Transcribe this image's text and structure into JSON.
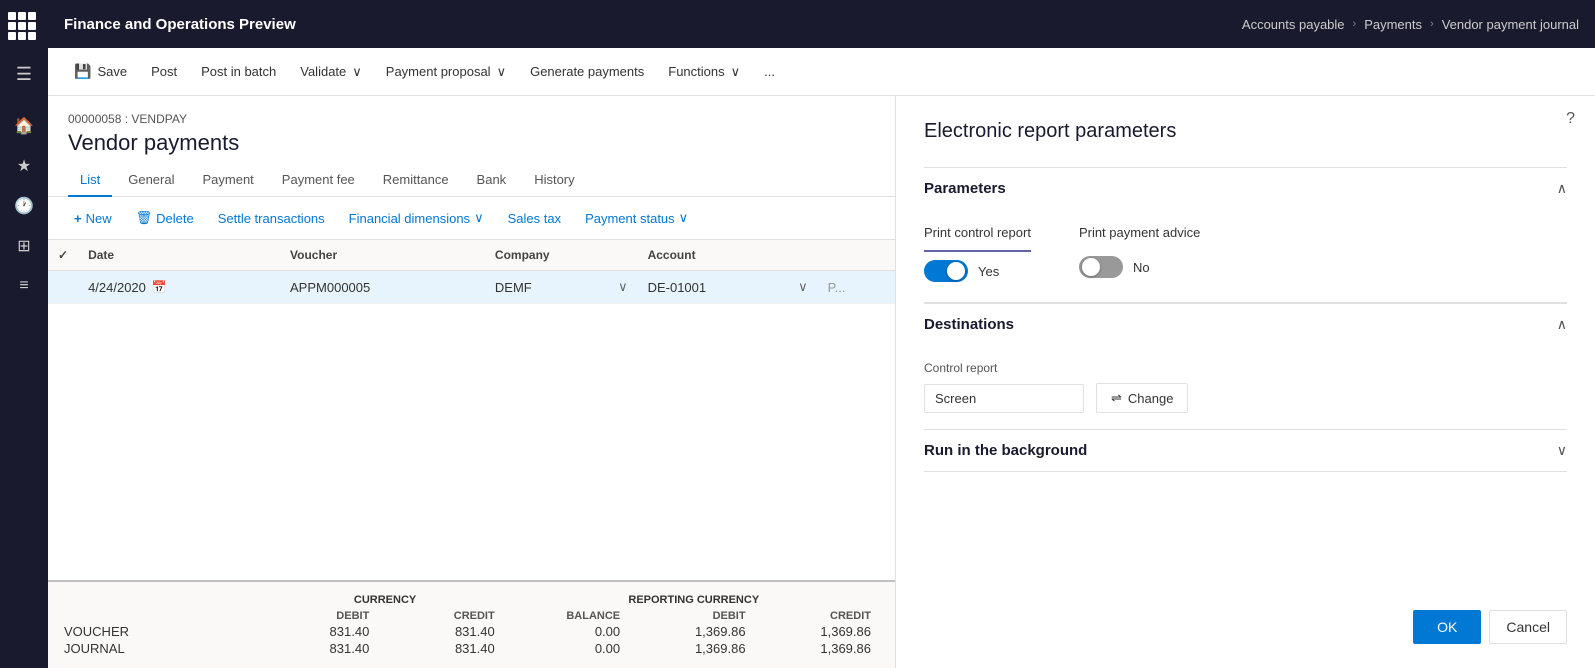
{
  "app": {
    "title": "Finance and Operations Preview",
    "grid_icon": "apps-icon"
  },
  "breadcrumb": {
    "items": [
      "Accounts payable",
      "Payments",
      "Vendor payment journal"
    ]
  },
  "toolbar": {
    "save_label": "Save",
    "post_label": "Post",
    "post_batch_label": "Post in batch",
    "validate_label": "Validate",
    "payment_proposal_label": "Payment proposal",
    "generate_payments_label": "Generate payments",
    "functions_label": "Functions",
    "more_label": "..."
  },
  "journal": {
    "id": "00000058 : VENDPAY",
    "title": "Vendor payments"
  },
  "tabs": [
    {
      "id": "list",
      "label": "List",
      "active": true
    },
    {
      "id": "general",
      "label": "General",
      "active": false
    },
    {
      "id": "payment",
      "label": "Payment",
      "active": false
    },
    {
      "id": "payment_fee",
      "label": "Payment fee",
      "active": false
    },
    {
      "id": "remittance",
      "label": "Remittance",
      "active": false
    },
    {
      "id": "bank",
      "label": "Bank",
      "active": false
    },
    {
      "id": "history",
      "label": "History",
      "active": false
    }
  ],
  "grid_toolbar": {
    "new_label": "New",
    "delete_label": "Delete",
    "settle_label": "Settle transactions",
    "financial_dim_label": "Financial dimensions",
    "sales_tax_label": "Sales tax",
    "payment_status_label": "Payment status"
  },
  "grid": {
    "columns": [
      "",
      "Date",
      "Voucher",
      "Company",
      "Account",
      ""
    ],
    "rows": [
      {
        "checked": false,
        "date": "4/24/2020",
        "voucher": "APPM000005",
        "company": "DEMF",
        "account": "DE-01001",
        "extra": "P..."
      }
    ]
  },
  "summary": {
    "currency_label": "CURRENCY",
    "reporting_currency_label": "REPORTING CURRENCY",
    "debit_label": "DEBIT",
    "credit_label": "CREDIT",
    "balance_label": "BALANCE",
    "rows": [
      {
        "label": "VOUCHER",
        "debit": "831.40",
        "credit": "831.40",
        "balance": "0.00",
        "r_debit": "1,369.86",
        "r_credit": "1,369.86",
        "r_balance": ""
      },
      {
        "label": "JOURNAL",
        "debit": "831.40",
        "credit": "831.40",
        "balance": "0.00",
        "r_debit": "1,369.86",
        "r_credit": "1,369.86",
        "r_balance": ""
      }
    ]
  },
  "report_panel": {
    "title": "Electronic report parameters",
    "parameters_label": "Parameters",
    "print_control_label": "Print control report",
    "print_control_value": "Yes",
    "print_control_on": true,
    "print_advice_label": "Print payment advice",
    "print_advice_value": "No",
    "print_advice_on": false,
    "destinations_label": "Destinations",
    "control_report_label": "Control report",
    "control_report_value": "Screen",
    "change_btn_label": "Change",
    "run_background_label": "Run in the background",
    "ok_label": "OK",
    "cancel_label": "Cancel",
    "help_label": "?"
  }
}
